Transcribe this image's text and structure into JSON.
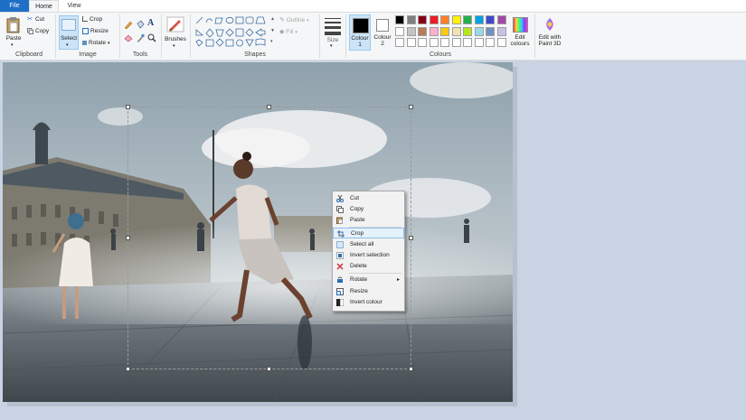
{
  "tabs": {
    "file": "File",
    "home": "Home",
    "view": "View"
  },
  "clipboard": {
    "paste": "Paste",
    "cut": "Cut",
    "copy": "Copy",
    "label": "Clipboard"
  },
  "image": {
    "select": "Select",
    "crop": "Crop",
    "resize": "Resize",
    "rotate": "Rotate",
    "label": "Image"
  },
  "tools": {
    "label": "Tools"
  },
  "brushes": {
    "label": "Brushes"
  },
  "shapes": {
    "outline": "Outline",
    "fill": "Fill",
    "label": "Shapes"
  },
  "size": {
    "label": "Size"
  },
  "colour1": {
    "line1": "Colour",
    "line2": "1"
  },
  "colour2": {
    "line1": "Colour",
    "line2": "2"
  },
  "colours": {
    "label": "Colours",
    "row1": [
      "#000000",
      "#7f7f7f",
      "#880015",
      "#ed1c24",
      "#ff7f27",
      "#fff200",
      "#22b14c",
      "#00a2e8",
      "#3f48cc",
      "#a349a4"
    ],
    "row2": [
      "#ffffff",
      "#c3c3c3",
      "#b97a57",
      "#ffaec9",
      "#ffc90e",
      "#efe4b0",
      "#b5e61d",
      "#99d9ea",
      "#7092be",
      "#c8bfe7"
    ]
  },
  "edit_colours": {
    "line1": "Edit",
    "line2": "colours"
  },
  "paint3d": {
    "line1": "Edit with",
    "line2": "Paint 3D"
  },
  "context_menu": [
    {
      "label": "Cut",
      "icon": "scissors-icon"
    },
    {
      "label": "Copy",
      "icon": "copy-icon"
    },
    {
      "label": "Paste",
      "icon": "paste-icon"
    },
    {
      "label": "Crop",
      "icon": "crop-icon"
    },
    {
      "label": "Select all",
      "icon": "select-all-icon"
    },
    {
      "label": "Invert selection",
      "icon": "invert-selection-icon"
    },
    {
      "label": "Delete",
      "icon": "delete-icon"
    },
    {
      "label": "Rotate",
      "icon": "rotate-icon"
    },
    {
      "label": "Resize",
      "icon": "resize-icon"
    },
    {
      "label": "Invert colour",
      "icon": "invert-colour-icon"
    }
  ]
}
